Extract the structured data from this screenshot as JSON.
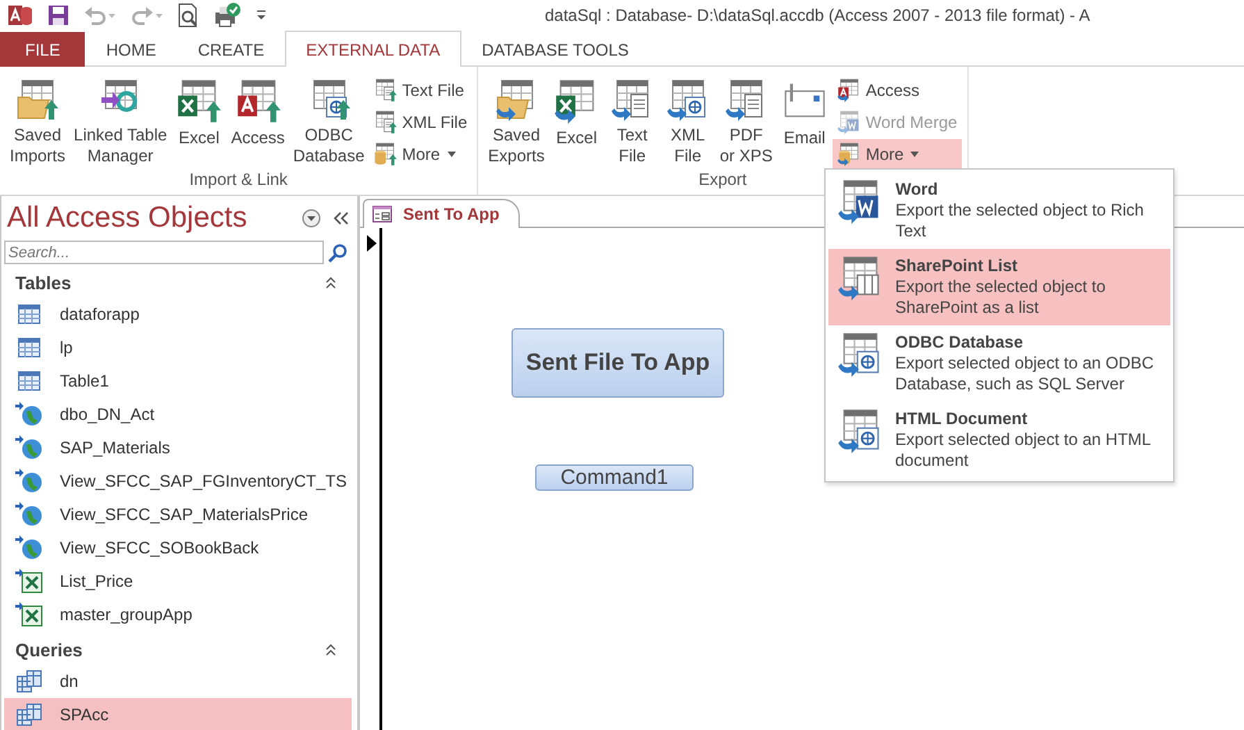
{
  "window": {
    "title": "dataSql : Database- D:\\dataSql.accdb (Access 2007 - 2013 file format) - A"
  },
  "tabs": [
    {
      "label": "FILE",
      "kind": "file",
      "selected": false
    },
    {
      "label": "HOME",
      "kind": "tab",
      "selected": false
    },
    {
      "label": "CREATE",
      "kind": "tab",
      "selected": false
    },
    {
      "label": "EXTERNAL DATA",
      "kind": "tab",
      "selected": true
    },
    {
      "label": "DATABASE TOOLS",
      "kind": "tab",
      "selected": false
    }
  ],
  "ribbon": {
    "groups": [
      {
        "label": "Import & Link",
        "large_buttons": [
          {
            "label": "Saved\nImports",
            "kind": "saved-import"
          },
          {
            "label": "Linked Table\nManager",
            "kind": "linked"
          },
          {
            "label": "Excel",
            "kind": "excel-import"
          },
          {
            "label": "Access",
            "kind": "access-import"
          },
          {
            "label": "ODBC\nDatabase",
            "kind": "odbc-import"
          }
        ],
        "small_buttons": [
          {
            "label": "Text File",
            "kind": "text-import",
            "disabled": false,
            "selected": false,
            "dropdown": false
          },
          {
            "label": "XML File",
            "kind": "xml-import",
            "disabled": false,
            "selected": false,
            "dropdown": false
          },
          {
            "label": "More",
            "kind": "more-import",
            "disabled": false,
            "selected": false,
            "dropdown": true
          }
        ]
      },
      {
        "label": "Export",
        "large_buttons": [
          {
            "label": "Saved\nExports",
            "kind": "saved-export"
          },
          {
            "label": "Excel",
            "kind": "excel-export"
          },
          {
            "label": "Text\nFile",
            "kind": "text-export"
          },
          {
            "label": "XML\nFile",
            "kind": "xml-export"
          },
          {
            "label": "PDF\nor XPS",
            "kind": "pdf-export"
          },
          {
            "label": "Email",
            "kind": "email"
          }
        ],
        "small_buttons": [
          {
            "label": "Access",
            "kind": "access-export",
            "disabled": false,
            "selected": false,
            "dropdown": false
          },
          {
            "label": "Word Merge",
            "kind": "word-merge",
            "disabled": true,
            "selected": false,
            "dropdown": false
          },
          {
            "label": "More",
            "kind": "more-export",
            "disabled": false,
            "selected": true,
            "dropdown": true
          }
        ]
      }
    ]
  },
  "navigation_pane": {
    "title": "All Access Objects",
    "search": {
      "placeholder": "Search..."
    },
    "groups": [
      {
        "label": "Tables",
        "items": [
          {
            "name": "dataforapp",
            "kind": "table",
            "selected": false
          },
          {
            "name": "lp",
            "kind": "table",
            "selected": false
          },
          {
            "name": "Table1",
            "kind": "table",
            "selected": false
          },
          {
            "name": "dbo_DN_Act",
            "kind": "linked-odbc",
            "selected": false
          },
          {
            "name": "SAP_Materials",
            "kind": "linked-odbc",
            "selected": false
          },
          {
            "name": "View_SFCC_SAP_FGInventoryCT_TS",
            "kind": "linked-odbc",
            "selected": false
          },
          {
            "name": "View_SFCC_SAP_MaterialsPrice",
            "kind": "linked-odbc",
            "selected": false
          },
          {
            "name": "View_SFCC_SOBookBack",
            "kind": "linked-odbc",
            "selected": false
          },
          {
            "name": "List_Price",
            "kind": "linked-excel",
            "selected": false
          },
          {
            "name": "master_groupApp",
            "kind": "linked-excel",
            "selected": false
          }
        ]
      },
      {
        "label": "Queries",
        "items": [
          {
            "name": "dn",
            "kind": "query",
            "selected": false
          },
          {
            "name": "SPAcc",
            "kind": "query",
            "selected": true
          }
        ]
      }
    ]
  },
  "document": {
    "tab": {
      "label": "Sent To App"
    },
    "buttons": [
      {
        "label": "Sent File To App",
        "kind": "large"
      },
      {
        "label": "Command1",
        "kind": "small"
      }
    ]
  },
  "export_more_menu": {
    "items": [
      {
        "title": "Word",
        "description": "Export the selected object to Rich Text",
        "kind": "word",
        "selected": false
      },
      {
        "title": "SharePoint List",
        "description": "Export the selected object to SharePoint as a list",
        "kind": "sharepoint",
        "selected": true
      },
      {
        "title": "ODBC Database",
        "description": "Export selected object to an ODBC Database, such as SQL Server",
        "kind": "odbc",
        "selected": false
      },
      {
        "title": "HTML Document",
        "description": "Export selected object to an HTML document",
        "kind": "html",
        "selected": false
      }
    ]
  }
}
